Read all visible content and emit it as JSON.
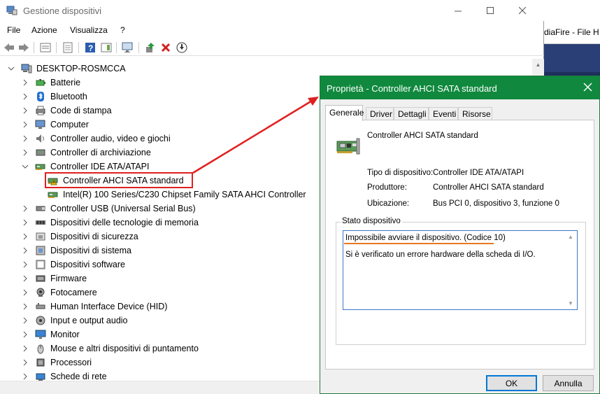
{
  "background_window": {
    "partial_title": "diaFire - File H"
  },
  "main_window": {
    "title": "Gestione dispositivi",
    "menu": [
      "File",
      "Azione",
      "Visualizza",
      "?"
    ],
    "tree": {
      "root": "DESKTOP-ROSMCCA",
      "items": [
        {
          "label": "Batterie",
          "icon": "battery-icon",
          "expanded": false
        },
        {
          "label": "Bluetooth",
          "icon": "bluetooth-icon",
          "expanded": false
        },
        {
          "label": "Code di stampa",
          "icon": "printer-icon",
          "expanded": false
        },
        {
          "label": "Computer",
          "icon": "computer-icon",
          "expanded": false
        },
        {
          "label": "Controller audio, video e giochi",
          "icon": "speaker-icon",
          "expanded": false
        },
        {
          "label": "Controller di archiviazione",
          "icon": "storage-icon",
          "expanded": false
        },
        {
          "label": "Controller IDE ATA/ATAPI",
          "icon": "ide-controller-icon",
          "expanded": true
        },
        {
          "label": "Controller AHCI SATA standard",
          "icon": "warning-controller-icon",
          "child": true,
          "highlighted": true
        },
        {
          "label": "Intel(R) 100 Series/C230 Chipset Family SATA AHCI Controller",
          "icon": "ide-controller-icon",
          "child": true
        },
        {
          "label": "Controller USB (Universal Serial Bus)",
          "icon": "usb-icon",
          "expanded": false
        },
        {
          "label": "Dispositivi delle tecnologie di memoria",
          "icon": "memory-icon",
          "expanded": false
        },
        {
          "label": "Dispositivi di sicurezza",
          "icon": "security-icon",
          "expanded": false
        },
        {
          "label": "Dispositivi di sistema",
          "icon": "system-device-icon",
          "expanded": false
        },
        {
          "label": "Dispositivi software",
          "icon": "software-device-icon",
          "expanded": false
        },
        {
          "label": "Firmware",
          "icon": "firmware-icon",
          "expanded": false
        },
        {
          "label": "Fotocamere",
          "icon": "camera-icon",
          "expanded": false
        },
        {
          "label": "Human Interface Device (HID)",
          "icon": "hid-icon",
          "expanded": false
        },
        {
          "label": "Input e output audio",
          "icon": "audio-io-icon",
          "expanded": false
        },
        {
          "label": "Monitor",
          "icon": "monitor-icon",
          "expanded": false
        },
        {
          "label": "Mouse e altri dispositivi di puntamento",
          "icon": "mouse-icon",
          "expanded": false
        },
        {
          "label": "Processori",
          "icon": "processor-icon",
          "expanded": false
        },
        {
          "label": "Schede di rete",
          "icon": "network-icon",
          "expanded": false
        }
      ]
    }
  },
  "dialog": {
    "title": "Proprietà - Controller AHCI SATA standard",
    "tabs": [
      "Generale",
      "Driver",
      "Dettagli",
      "Eventi",
      "Risorse"
    ],
    "active_tab": "Generale",
    "device_name": "Controller AHCI SATA standard",
    "properties": [
      {
        "label": "Tipo di dispositivo:",
        "value": "Controller IDE ATA/ATAPI"
      },
      {
        "label": "Produttore:",
        "value": "Controller AHCI SATA standard"
      },
      {
        "label": "Ubicazione:",
        "value": "Bus PCI 0, dispositivo 3, funzione 0"
      }
    ],
    "status_group_label": "Stato dispositivo",
    "status_line1": "Impossibile avviare il dispositivo. (Codice 10)",
    "status_line2": "Si è verificato un errore hardware della scheda di I/O.",
    "ok_label": "OK",
    "cancel_label": "Annulla"
  },
  "colors": {
    "dialog_titlebar": "#10893e",
    "highlight_box": "#e02020",
    "status_underline": "#e87722",
    "ok_focus": "#0078d7"
  }
}
